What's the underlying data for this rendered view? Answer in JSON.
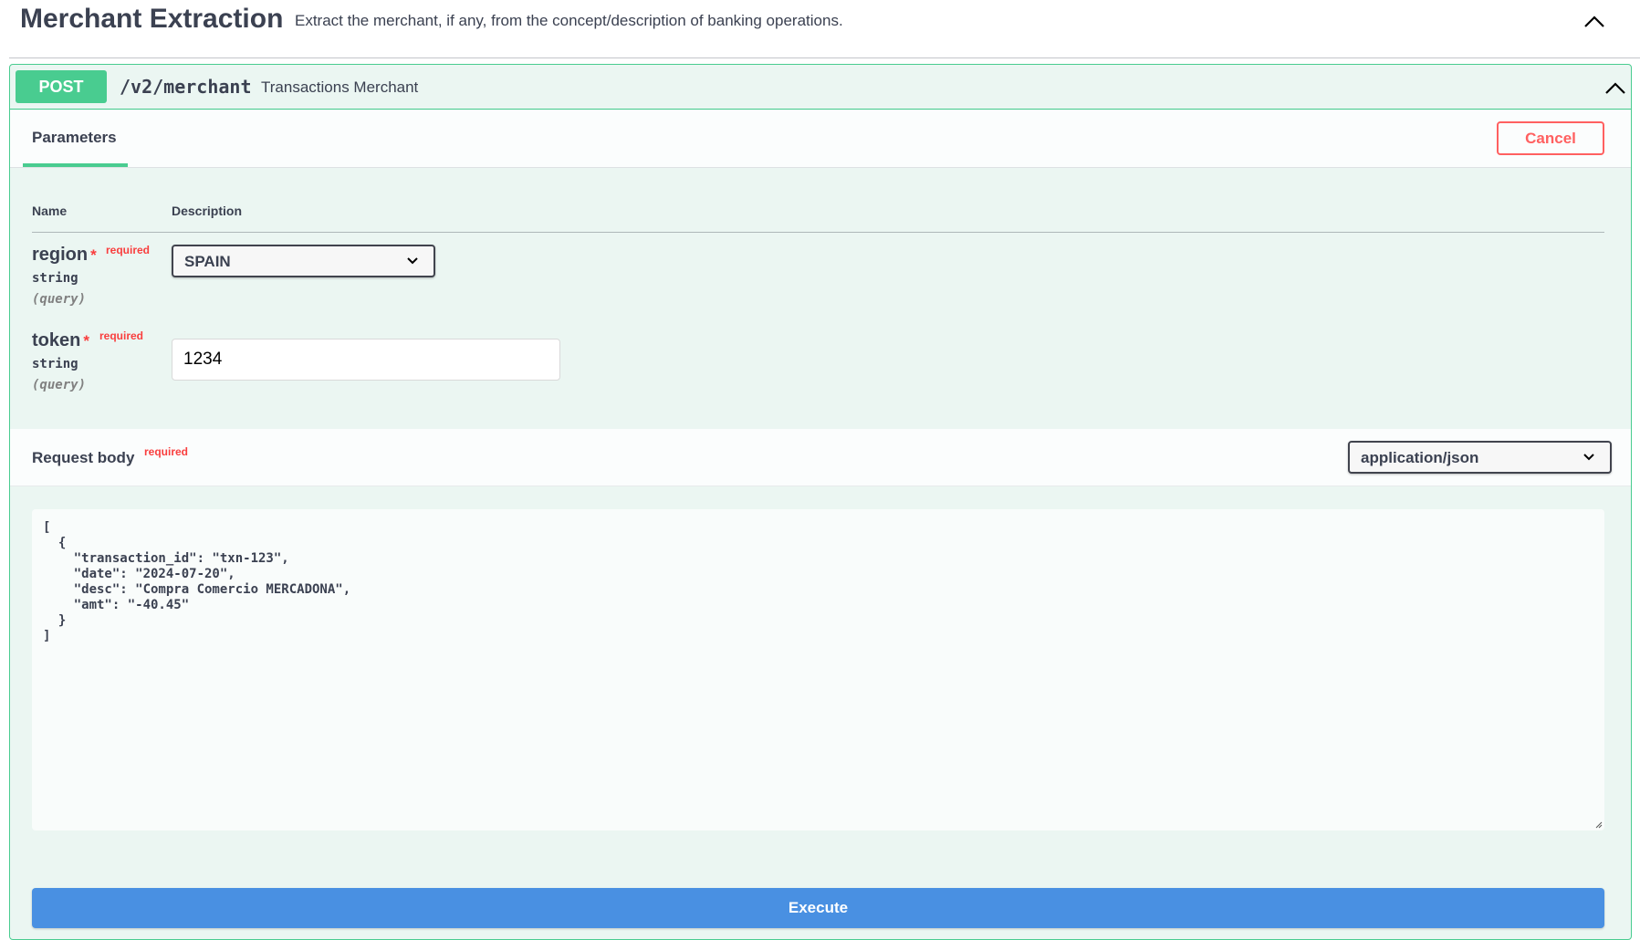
{
  "tag": {
    "title": "Merchant Extraction",
    "description": "Extract the merchant, if any, from the concept/description of banking operations."
  },
  "operation": {
    "method": "POST",
    "path": "/v2/merchant",
    "summary": "Transactions Merchant"
  },
  "parameters_section": {
    "tab_label": "Parameters",
    "cancel_label": "Cancel",
    "columns": {
      "name": "Name",
      "description": "Description"
    }
  },
  "params": [
    {
      "name": "region",
      "required_star": "*",
      "required_label": "required",
      "type": "string",
      "in": "(query)",
      "value": "SPAIN"
    },
    {
      "name": "token",
      "required_star": "*",
      "required_label": "required",
      "type": "string",
      "in": "(query)",
      "value": "1234"
    }
  ],
  "request_body": {
    "title": "Request body",
    "required_label": "required",
    "content_type": "application/json",
    "value": "[\n  {\n    \"transaction_id\": \"txn-123\",\n    \"date\": \"2024-07-20\",\n    \"desc\": \"Compra Comercio MERCADONA\",\n    \"amt\": \"-40.45\"\n  }\n]"
  },
  "execute_label": "Execute",
  "colors": {
    "post_green": "#49cc90",
    "block_bg": "#ebf6f2",
    "cancel_red": "#ff6060",
    "required_red": "#f93e3e",
    "execute_blue": "#4990e2"
  },
  "icons": {
    "tag_toggle": "chevron-up-icon",
    "operation_toggle": "chevron-up-icon",
    "select_arrow": "chevron-down-icon"
  }
}
